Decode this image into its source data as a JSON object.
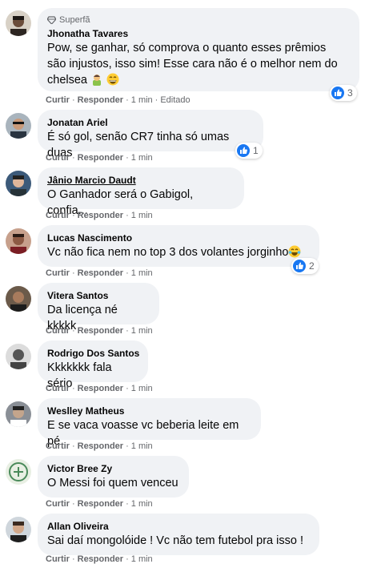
{
  "comments": [
    {
      "badge": "Superfã",
      "author": "Jhonatha Tavares",
      "lines": [
        "Pow, se ganhar, só comprova o quanto esses prêmios",
        "são injustos, isso sim! Esse cara não é o melhor nem do",
        "chelsea"
      ],
      "like": "Curtir",
      "reply": "Responder",
      "time": "1 min",
      "edited": "Editado",
      "reactions": "3"
    },
    {
      "author": "Jonatan Ariel",
      "lines": [
        "É só gol, senão CR7 tinha só umas duas"
      ],
      "like": "Curtir",
      "reply": "Responder",
      "time": "1 min",
      "reactions": "1"
    },
    {
      "author": "Jânio Marcio Daudt",
      "lines": [
        "O Ganhador será o Gabigol, confia..."
      ],
      "like": "Curtir",
      "reply": "Responder",
      "time": "1 min"
    },
    {
      "author": "Lucas Nascimento",
      "lines": [
        "Vc não fica nem no top 3 dos volantes jorginho"
      ],
      "like": "Curtir",
      "reply": "Responder",
      "time": "1 min",
      "reactions": "2"
    },
    {
      "author": "Vitera Santos",
      "lines": [
        "Da licença né kkkkk"
      ],
      "like": "Curtir",
      "reply": "Responder",
      "time": "1 min"
    },
    {
      "author": "Rodrigo Dos Santos",
      "lines": [
        "Kkkkkkk fala sério"
      ],
      "like": "Curtir",
      "reply": "Responder",
      "time": "1 min"
    },
    {
      "author": "Weslley Matheus",
      "lines": [
        "E se vaca voasse vc beberia leite em pé"
      ],
      "like": "Curtir",
      "reply": "Responder",
      "time": "1 min"
    },
    {
      "author": "Victor Bree Zy",
      "lines": [
        "O Messi foi quem venceu"
      ],
      "like": "Curtir",
      "reply": "Responder",
      "time": "1 min"
    },
    {
      "author": "Allan Oliveira",
      "lines": [
        "Sai daí mongolóide ! Vc não tem futebol pra isso !"
      ],
      "like": "Curtir",
      "reply": "Responder",
      "time": "1 min"
    }
  ],
  "colors": {
    "like_blue": "#1877f2",
    "bubble": "#f0f2f5",
    "meta": "#65676b"
  },
  "icons": [
    "diamond-icon",
    "like-reaction-icon",
    "man-emoji-icon",
    "grin-emoji-icon",
    "laughing-tears-emoji-icon"
  ]
}
